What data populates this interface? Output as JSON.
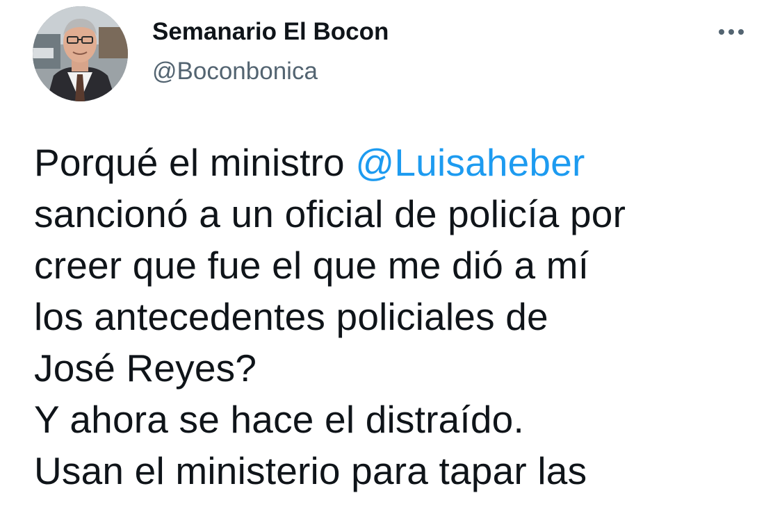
{
  "author": {
    "name": "Semanario El Bocon",
    "handle": "@Boconbonica"
  },
  "more_icon": "more-horizontal-icon",
  "tweet": {
    "line1_prefix": "Porqué el ministro ",
    "line1_mention": "@Luisaheber",
    "line2": "sancionó a un oficial de policía por",
    "line3": "creer que fue el que me dió a mí",
    "line4": "los antecedentes policiales de",
    "line5": "José Reyes?",
    "line6": "Y ahora se hace el distraído.",
    "line7": "Usan el ministerio para tapar las"
  },
  "colors": {
    "text": "#0f1419",
    "secondary": "#536471",
    "link": "#1d9bf0",
    "background": "#ffffff"
  }
}
